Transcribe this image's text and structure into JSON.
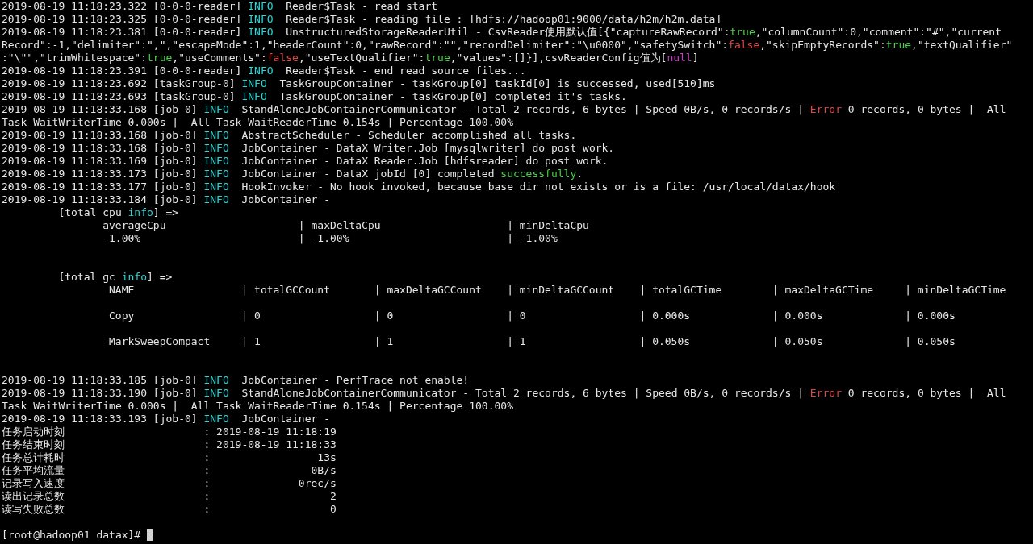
{
  "log": [
    {
      "segments": [
        {
          "kind": "plain",
          "text": "2019-08-19 11:18:23.322 [0-0-0-reader] "
        },
        {
          "kind": "keyword",
          "text": "INFO"
        },
        {
          "kind": "plain",
          "text": "  Reader$Task - read start"
        }
      ]
    },
    {
      "segments": [
        {
          "kind": "plain",
          "text": "2019-08-19 11:18:23.325 [0-0-0-reader] "
        },
        {
          "kind": "keyword",
          "text": "INFO"
        },
        {
          "kind": "plain",
          "text": "  Reader$Task - reading file : [hdfs://hadoop01:9000/data/h2m/h2m.data]"
        }
      ]
    },
    {
      "segments": [
        {
          "kind": "plain",
          "text": "2019-08-19 11:18:23.381 [0-0-0-reader] "
        },
        {
          "kind": "keyword",
          "text": "INFO"
        },
        {
          "kind": "plain",
          "text": "  UnstructuredStorageReaderUtil - CsvReader使用默认值[{\"captureRawRecord\":"
        },
        {
          "kind": "success",
          "text": "true"
        },
        {
          "kind": "plain",
          "text": ",\"columnCount\":0,\"comment\":\"#\",\"current"
        }
      ]
    },
    {
      "segments": [
        {
          "kind": "plain",
          "text": "Record\":-1,\"delimiter\":\",\",\"escapeMode\":1,\"headerCount\":0,\"rawRecord\":\"\",\"recordDelimiter\":\"\\u0000\",\"safetySwitch\":"
        },
        {
          "kind": "error",
          "text": "false"
        },
        {
          "kind": "plain",
          "text": ",\"skipEmptyRecords\":"
        },
        {
          "kind": "success",
          "text": "true"
        },
        {
          "kind": "plain",
          "text": ",\"textQualifier\""
        }
      ]
    },
    {
      "segments": [
        {
          "kind": "plain",
          "text": ":\"\\\"\",\"trimWhitespace\":"
        },
        {
          "kind": "success",
          "text": "true"
        },
        {
          "kind": "plain",
          "text": ",\"useComments\":"
        },
        {
          "kind": "error",
          "text": "false"
        },
        {
          "kind": "plain",
          "text": ",\"useTextQualifier\":"
        },
        {
          "kind": "success",
          "text": "true"
        },
        {
          "kind": "plain",
          "text": ",\"values\":[]}],csvReaderConfig值为["
        },
        {
          "kind": "null",
          "text": "null"
        },
        {
          "kind": "plain",
          "text": "]"
        }
      ]
    },
    {
      "segments": [
        {
          "kind": "plain",
          "text": "2019-08-19 11:18:23.391 [0-0-0-reader] "
        },
        {
          "kind": "keyword",
          "text": "INFO"
        },
        {
          "kind": "plain",
          "text": "  Reader$Task - end read source files..."
        }
      ]
    },
    {
      "segments": [
        {
          "kind": "plain",
          "text": "2019-08-19 11:18:23.692 [taskGroup-0] "
        },
        {
          "kind": "keyword",
          "text": "INFO"
        },
        {
          "kind": "plain",
          "text": "  TaskGroupContainer - taskGroup[0] taskId[0] is successed, used[510]ms"
        }
      ]
    },
    {
      "segments": [
        {
          "kind": "plain",
          "text": "2019-08-19 11:18:23.693 [taskGroup-0] "
        },
        {
          "kind": "keyword",
          "text": "INFO"
        },
        {
          "kind": "plain",
          "text": "  TaskGroupContainer - taskGroup[0] completed it's tasks."
        }
      ]
    },
    {
      "segments": [
        {
          "kind": "plain",
          "text": "2019-08-19 11:18:33.168 [job-0] "
        },
        {
          "kind": "keyword",
          "text": "INFO"
        },
        {
          "kind": "plain",
          "text": "  StandAloneJobContainerCommunicator - Total 2 records, 6 bytes | Speed 0B/s, 0 records/s | "
        },
        {
          "kind": "error",
          "text": "Error"
        },
        {
          "kind": "plain",
          "text": " 0 records, 0 bytes |  All"
        }
      ]
    },
    {
      "segments": [
        {
          "kind": "plain",
          "text": "Task WaitWriterTime 0.000s |  All Task WaitReaderTime 0.154s | Percentage 100.00%"
        }
      ]
    },
    {
      "segments": [
        {
          "kind": "plain",
          "text": "2019-08-19 11:18:33.168 [job-0] "
        },
        {
          "kind": "keyword",
          "text": "INFO"
        },
        {
          "kind": "plain",
          "text": "  AbstractScheduler - Scheduler accomplished all tasks."
        }
      ]
    },
    {
      "segments": [
        {
          "kind": "plain",
          "text": "2019-08-19 11:18:33.168 [job-0] "
        },
        {
          "kind": "keyword",
          "text": "INFO"
        },
        {
          "kind": "plain",
          "text": "  JobContainer - DataX Writer.Job [mysqlwriter] do post work."
        }
      ]
    },
    {
      "segments": [
        {
          "kind": "plain",
          "text": "2019-08-19 11:18:33.169 [job-0] "
        },
        {
          "kind": "keyword",
          "text": "INFO"
        },
        {
          "kind": "plain",
          "text": "  JobContainer - DataX Reader.Job [hdfsreader] do post work."
        }
      ]
    },
    {
      "segments": [
        {
          "kind": "plain",
          "text": "2019-08-19 11:18:33.173 [job-0] "
        },
        {
          "kind": "keyword",
          "text": "INFO"
        },
        {
          "kind": "plain",
          "text": "  JobContainer - DataX jobId [0] completed "
        },
        {
          "kind": "success",
          "text": "successfully"
        },
        {
          "kind": "plain",
          "text": "."
        }
      ]
    },
    {
      "segments": [
        {
          "kind": "plain",
          "text": "2019-08-19 11:18:33.177 [job-0] "
        },
        {
          "kind": "keyword",
          "text": "INFO"
        },
        {
          "kind": "plain",
          "text": "  HookInvoker - No hook invoked, because base dir not exists or is a file: /usr/local/datax/hook"
        }
      ]
    },
    {
      "segments": [
        {
          "kind": "plain",
          "text": "2019-08-19 11:18:33.184 [job-0] "
        },
        {
          "kind": "keyword",
          "text": "INFO"
        },
        {
          "kind": "plain",
          "text": "  JobContainer -"
        }
      ]
    }
  ],
  "cpu_info": {
    "heading": [
      {
        "kind": "plain",
        "text": "[total cpu "
      },
      {
        "kind": "keyword",
        "text": "info"
      },
      {
        "kind": "plain",
        "text": "] =>"
      }
    ],
    "rows": [
      "averageCpu                     | maxDeltaCpu                    | minDeltaCpu",
      "-1.00%                         | -1.00%                         | -1.00%"
    ]
  },
  "gc_info": {
    "heading": [
      {
        "kind": "plain",
        "text": "[total gc "
      },
      {
        "kind": "keyword",
        "text": "info"
      },
      {
        "kind": "plain",
        "text": "] =>"
      }
    ],
    "rows": [
      "NAME                 | totalGCCount       | maxDeltaGCCount    | minDeltaGCCount    | totalGCTime        | maxDeltaGCTime     | minDeltaGCTime",
      "Copy                 | 0                  | 0                  | 0                  | 0.000s             | 0.000s             | 0.000s",
      "MarkSweepCompact     | 1                  | 1                  | 1                  | 0.050s             | 0.050s             | 0.050s"
    ]
  },
  "log_tail": [
    {
      "segments": [
        {
          "kind": "plain",
          "text": "2019-08-19 11:18:33.185 [job-0] "
        },
        {
          "kind": "keyword",
          "text": "INFO"
        },
        {
          "kind": "plain",
          "text": "  JobContainer - PerfTrace not enable!"
        }
      ]
    },
    {
      "segments": [
        {
          "kind": "plain",
          "text": "2019-08-19 11:18:33.190 [job-0] "
        },
        {
          "kind": "keyword",
          "text": "INFO"
        },
        {
          "kind": "plain",
          "text": "  StandAloneJobContainerCommunicator - Total 2 records, 6 bytes | Speed 0B/s, 0 records/s | "
        },
        {
          "kind": "error",
          "text": "Error"
        },
        {
          "kind": "plain",
          "text": " 0 records, 0 bytes |  All"
        }
      ]
    },
    {
      "segments": [
        {
          "kind": "plain",
          "text": "Task WaitWriterTime 0.000s |  All Task WaitReaderTime 0.154s | Percentage 100.00%"
        }
      ]
    },
    {
      "segments": [
        {
          "kind": "plain",
          "text": "2019-08-19 11:18:33.193 [job-0] "
        },
        {
          "kind": "keyword",
          "text": "INFO"
        },
        {
          "kind": "plain",
          "text": "  JobContainer -"
        }
      ]
    }
  ],
  "summary": [
    {
      "label": "任务启动时刻",
      "separator": ":",
      "value": "2019-08-19 11:18:19"
    },
    {
      "label": "任务结束时刻",
      "separator": ":",
      "value": "2019-08-19 11:18:33"
    },
    {
      "label": "任务总计耗时",
      "separator": ":",
      "value": "13s"
    },
    {
      "label": "任务平均流量",
      "separator": ":",
      "value": "0B/s"
    },
    {
      "label": "记录写入速度",
      "separator": ":",
      "value": "0rec/s"
    },
    {
      "label": "读出记录总数",
      "separator": ":",
      "value": "2"
    },
    {
      "label": "读写失败总数",
      "separator": ":",
      "value": "0"
    }
  ],
  "prompt": {
    "text": "[root@hadoop01 datax]#"
  }
}
